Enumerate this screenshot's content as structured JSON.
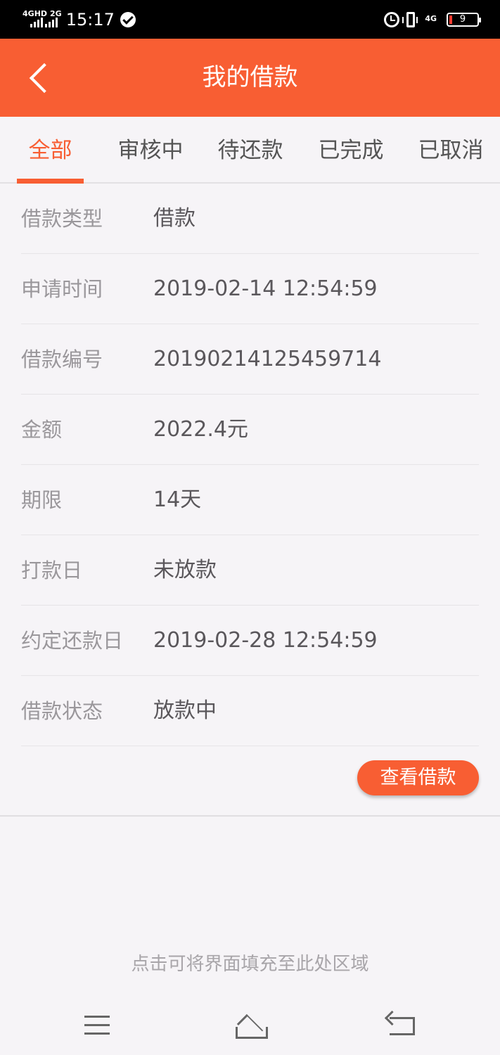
{
  "status_bar": {
    "network_left_top": "4G",
    "network_left_sub": "HD",
    "network_2g": "2G",
    "time": "15:17",
    "network_right": "4G",
    "battery_level": "9"
  },
  "header": {
    "title": "我的借款"
  },
  "tabs": [
    {
      "label": "全部",
      "active": true
    },
    {
      "label": "审核中",
      "active": false
    },
    {
      "label": "待还款",
      "active": false
    },
    {
      "label": "已完成",
      "active": false
    },
    {
      "label": "已取消",
      "active": false
    }
  ],
  "loan": {
    "rows": [
      {
        "label": "借款类型",
        "value": "借款"
      },
      {
        "label": "申请时间",
        "value": "2019-02-14 12:54:59"
      },
      {
        "label": "借款编号",
        "value": "20190214125459714"
      },
      {
        "label": "金额",
        "value": "2022.4元"
      },
      {
        "label": "期限",
        "value": "14天"
      },
      {
        "label": "打款日",
        "value": "未放款"
      },
      {
        "label": "约定还款日",
        "value": "2019-02-28 12:54:59"
      },
      {
        "label": "借款状态",
        "value": "放款中"
      }
    ],
    "view_button": "查看借款"
  },
  "fill_hint": "点击可将界面填充至此处区域",
  "colors": {
    "accent": "#f85e33",
    "background": "#f6f4f7"
  },
  "icons": {
    "back": "chevron-left-icon",
    "nav_menu": "menu-icon",
    "nav_home": "home-icon",
    "nav_back": "return-icon"
  }
}
